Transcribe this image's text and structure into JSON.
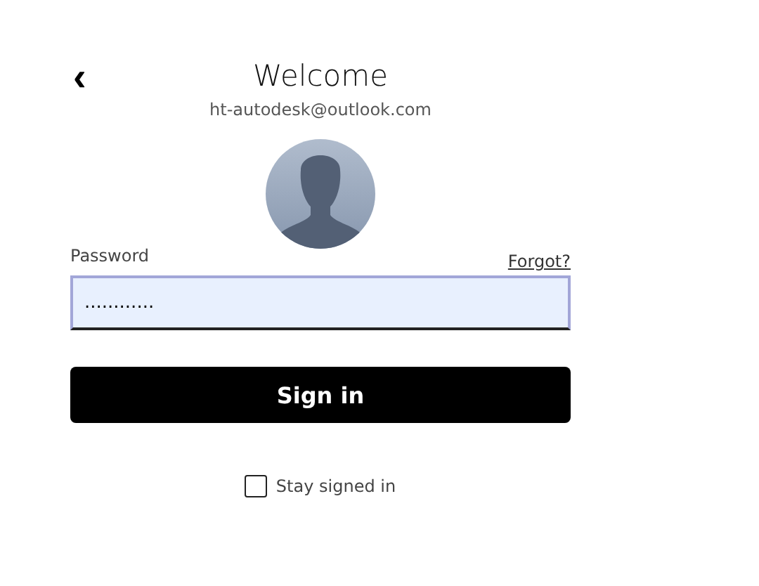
{
  "header": {
    "back_symbol": "‹",
    "title": "Welcome",
    "email": "ht-autodesk@outlook.com"
  },
  "password": {
    "label": "Password",
    "forgot_link": "Forgot?",
    "value": "............",
    "focused": true
  },
  "sign_in_button": "Sign in",
  "stay_signed_in": {
    "label": "Stay signed in",
    "checked": false
  }
}
